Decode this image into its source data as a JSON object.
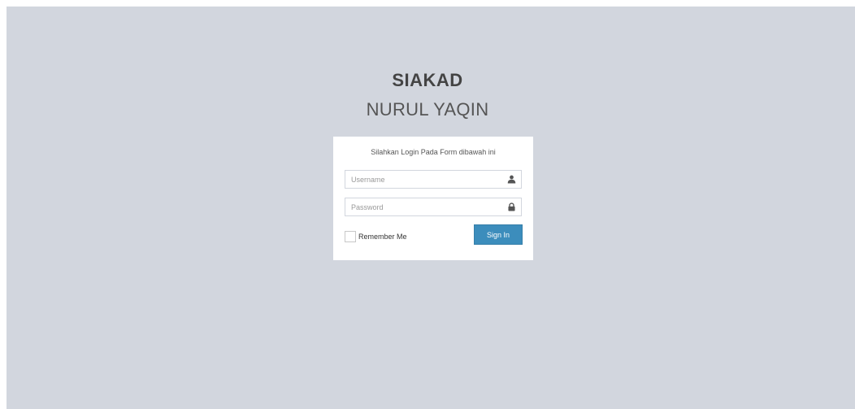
{
  "app": {
    "title": "SIAKAD",
    "subtitle": "NURUL YAQIN"
  },
  "login": {
    "message": "Silahkan Login Pada Form dibawah ini",
    "username": {
      "placeholder": "Username",
      "value": "",
      "icon": "user-icon"
    },
    "password": {
      "placeholder": "Password",
      "value": "",
      "icon": "lock-icon"
    },
    "remember_label": "Remember Me",
    "remember_checked": false,
    "signin_label": "Sign In"
  },
  "colors": {
    "background": "#d2d6de",
    "box": "#ffffff",
    "primary_button": "#3c8dbc",
    "text": "#444444"
  }
}
